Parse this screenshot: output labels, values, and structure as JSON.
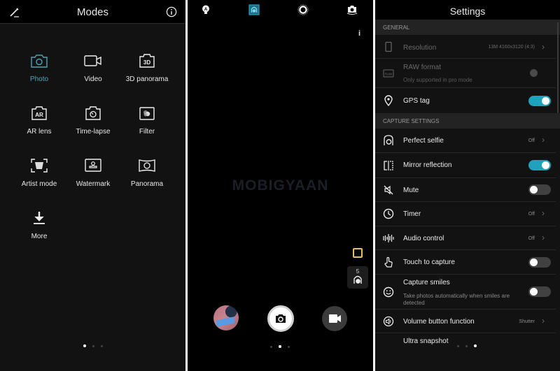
{
  "modes_screen": {
    "title": "Modes",
    "edit_icon": "pencil-icon",
    "info_icon": "info-icon",
    "accent_color": "#4fa3b8",
    "modes": [
      {
        "label": "Photo",
        "icon": "camera-icon",
        "active": true
      },
      {
        "label": "Video",
        "icon": "video-icon",
        "active": false
      },
      {
        "label": "3D panorama",
        "icon": "3d-panorama-icon",
        "active": false
      },
      {
        "label": "AR lens",
        "icon": "ar-lens-icon",
        "active": false
      },
      {
        "label": "Time-lapse",
        "icon": "time-lapse-icon",
        "active": false
      },
      {
        "label": "Filter",
        "icon": "filter-icon",
        "active": false
      },
      {
        "label": "Artist mode",
        "icon": "artist-mode-icon",
        "active": false
      },
      {
        "label": "Watermark",
        "icon": "watermark-icon",
        "active": false
      },
      {
        "label": "Panorama",
        "icon": "panorama-icon",
        "active": false
      },
      {
        "label": "More",
        "icon": "download-icon",
        "active": false
      }
    ],
    "page_indicator": {
      "total": 3,
      "current": 1
    }
  },
  "camera_screen": {
    "top_icons": [
      "flash-auto-icon",
      "beauty-mode-icon",
      "live-photo-icon",
      "switch-camera-icon"
    ],
    "info_label": "i",
    "watermark_text": "MOBIGYAAN",
    "burst_count": "5",
    "active_color": "#1fa3bd",
    "page_indicator": {
      "total": 3,
      "current": 2
    }
  },
  "settings_screen": {
    "title": "Settings",
    "toggle_on_color": "#1fa3bd",
    "sections": [
      {
        "header": "GENERAL",
        "rows": [
          {
            "label": "Resolution",
            "value": "13M 4160x3120 (4:3)",
            "type": "nav",
            "disabled": true,
            "icon": "phone-outline-icon"
          },
          {
            "label": "RAW format",
            "sublabel": "Only supported in pro mode",
            "type": "toggle",
            "state": "off",
            "disabled": true,
            "icon": "raw-icon"
          },
          {
            "label": "GPS tag",
            "type": "toggle",
            "state": "on",
            "disabled": false,
            "icon": "location-pin-icon"
          }
        ]
      },
      {
        "header": "CAPTURE SETTINGS",
        "rows": [
          {
            "label": "Perfect selfie",
            "value": "Off",
            "type": "nav",
            "icon": "selfie-icon"
          },
          {
            "label": "Mirror reflection",
            "type": "toggle",
            "state": "on",
            "icon": "mirror-icon"
          },
          {
            "label": "Mute",
            "type": "toggle",
            "state": "off",
            "icon": "mute-icon"
          },
          {
            "label": "Timer",
            "value": "Off",
            "type": "nav",
            "icon": "clock-icon"
          },
          {
            "label": "Audio control",
            "value": "Off",
            "type": "nav",
            "icon": "audio-wave-icon"
          },
          {
            "label": "Touch to capture",
            "type": "toggle",
            "state": "off",
            "icon": "touch-icon"
          },
          {
            "label": "Capture smiles",
            "sublabel": "Take photos automatically when smiles are detected",
            "type": "toggle",
            "state": "off",
            "icon": "smile-icon"
          },
          {
            "label": "Volume button function",
            "value": "Shutter",
            "type": "nav",
            "icon": "volume-icon"
          },
          {
            "label": "Ultra snapshot",
            "type": "partial",
            "icon": ""
          }
        ]
      }
    ],
    "page_indicator": {
      "total": 3,
      "current": 3
    }
  }
}
